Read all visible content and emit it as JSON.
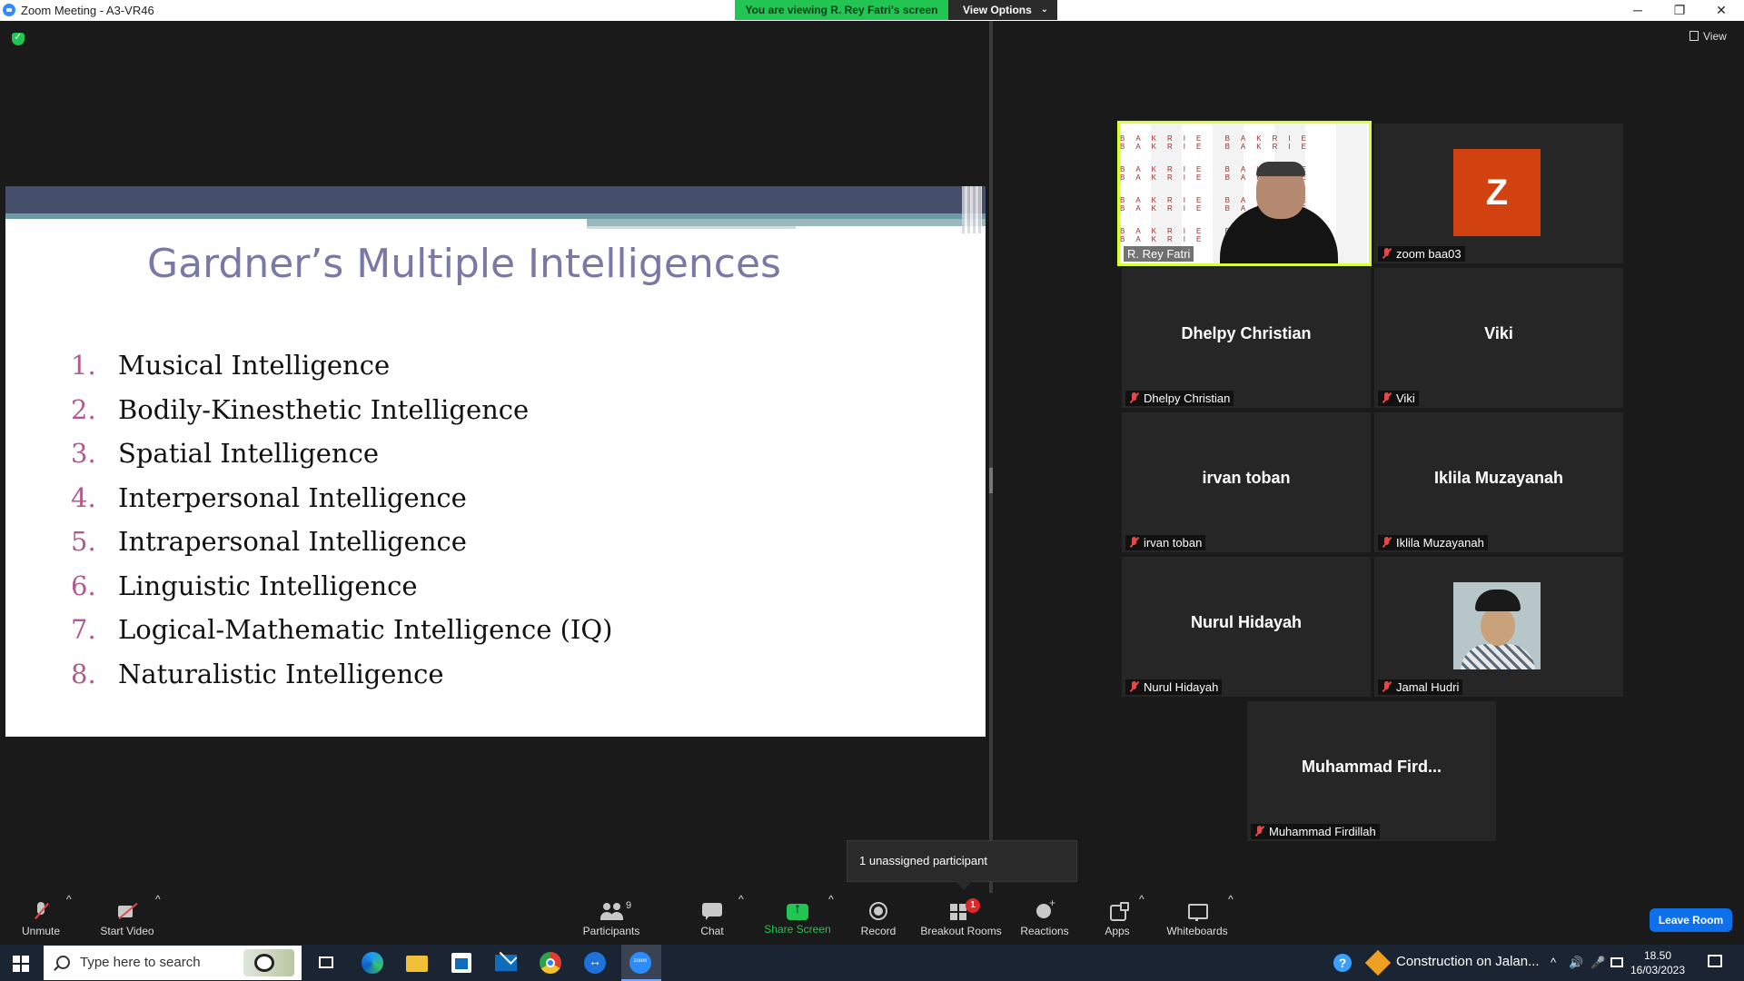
{
  "window": {
    "title": "Zoom Meeting - A3-VR46",
    "minimize": "─",
    "restore": "❐",
    "close": "✕"
  },
  "banner": {
    "viewing_text": "You are viewing R. Rey Fatri's screen",
    "view_options": "View Options",
    "chevron": "⌄"
  },
  "view_button": "View",
  "slide": {
    "title": "Gardner’s Multiple Intelligences",
    "items": [
      {
        "num": "1.",
        "text": "Musical Intelligence"
      },
      {
        "num": "2.",
        "text": "Bodily-Kinesthetic Intelligence"
      },
      {
        "num": "3.",
        "text": "Spatial Intelligence"
      },
      {
        "num": "4.",
        "text": "Interpersonal Intelligence"
      },
      {
        "num": "5.",
        "text": "Intrapersonal Intelligence"
      },
      {
        "num": "6.",
        "text": "Linguistic Intelligence"
      },
      {
        "num": "7.",
        "text": "Logical-Mathematic Intelligence (IQ)"
      },
      {
        "num": "8.",
        "text": "Naturalistic Intelligence"
      }
    ]
  },
  "participants": {
    "rey": {
      "label": "R. Rey Fatri",
      "backdrop_logo": "BAKRIE"
    },
    "zoom": {
      "label": "zoom baa03",
      "avatar": "Z"
    },
    "dhelpy": {
      "name": "Dhelpy Christian",
      "label": "Dhelpy Christian"
    },
    "viki": {
      "name": "Viki",
      "label": "Viki"
    },
    "irvan": {
      "name": "irvan toban",
      "label": "irvan toban"
    },
    "iklila": {
      "name": "Iklila Muzayanah",
      "label": "Iklila Muzayanah"
    },
    "nurul": {
      "name": "Nurul Hidayah",
      "label": "Nurul Hidayah"
    },
    "jamal": {
      "label": "Jamal Hudri"
    },
    "muhammad": {
      "name": "Muhammad  Fird...",
      "label": "Muhammad Firdillah"
    }
  },
  "tooltip": {
    "text": "1 unassigned participant"
  },
  "toolbar": {
    "unmute": "Unmute",
    "start_video": "Start Video",
    "participants": "Participants",
    "participants_count": "9",
    "chat": "Chat",
    "share_screen": "Share Screen",
    "record": "Record",
    "breakout_rooms": "Breakout Rooms",
    "breakout_badge": "1",
    "reactions": "Reactions",
    "apps": "Apps",
    "whiteboards": "Whiteboards",
    "caret": "^",
    "leave_room": "Leave Room",
    "share_color": "#23c552",
    "leave_color": "#0e71eb"
  },
  "taskbar": {
    "search_placeholder": "Type here to search",
    "weather": "Construction on Jalan...",
    "help": "?",
    "chevron_up": "^",
    "volume": "🔊",
    "mic": "🎤",
    "time": "18.50",
    "date": "16/03/2023"
  }
}
